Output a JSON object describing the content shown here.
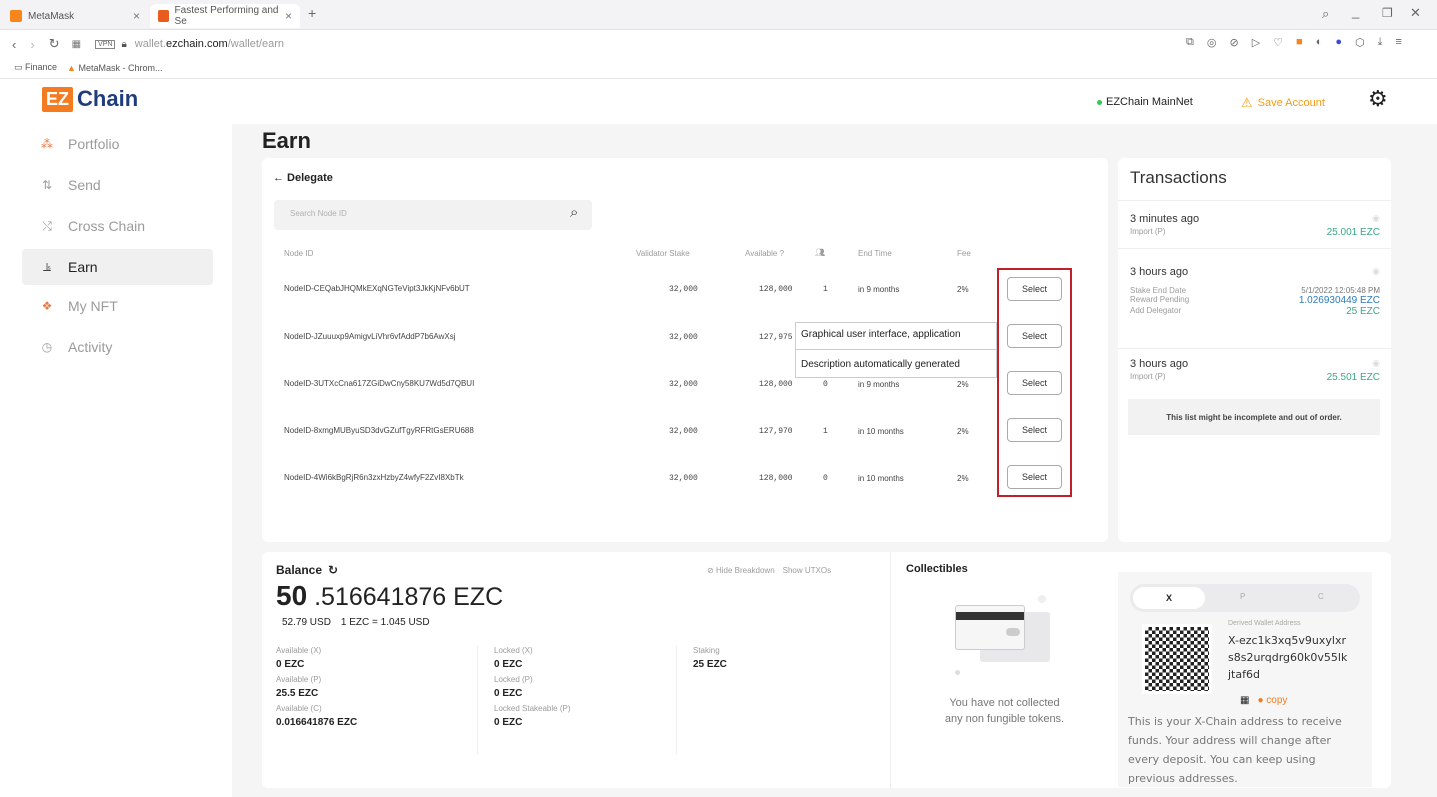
{
  "browser": {
    "tabs": [
      {
        "title": "MetaMask",
        "active": false
      },
      {
        "title": "Fastest Performing and Se",
        "active": true
      }
    ],
    "url_prefix": "wallet.",
    "url_domain": "ezchain.com",
    "url_path": "/wallet/earn",
    "bookmarks": [
      "Finance",
      "MetaMask - Chrom..."
    ]
  },
  "header": {
    "logo_badge": "EZ",
    "logo_text": "Chain",
    "network": "EZChain MainNet",
    "save_account": "Save Account",
    "network_color": "#34c759",
    "warn_color": "#f39c12"
  },
  "sidebar": {
    "items": [
      {
        "label": "Portfolio",
        "icon": "portfolio-icon"
      },
      {
        "label": "Send",
        "icon": "send-icon"
      },
      {
        "label": "Cross Chain",
        "icon": "cross-chain-icon"
      },
      {
        "label": "Earn",
        "icon": "earn-icon",
        "active": true
      },
      {
        "label": "My NFT",
        "icon": "nft-icon"
      },
      {
        "label": "Activity",
        "icon": "activity-icon"
      }
    ]
  },
  "earn": {
    "title": "Earn",
    "back_label": "← Delegate",
    "search_placeholder": "Search Node ID",
    "columns": {
      "node_id": "Node ID",
      "stake": "Validator Stake",
      "available": "Available",
      "delegators_icon": "users-icon",
      "end_time": "End Time",
      "fee": "Fee"
    },
    "rows": [
      {
        "node_id": "NodeID-CEQabJHQMkEXqNGTeVipt3JkKjNFv6bUT",
        "stake": "32,000",
        "available": "128,000",
        "delegators": "1",
        "end": "in 9 months",
        "fee": "2%",
        "select": "Select"
      },
      {
        "node_id": "NodeID-JZuuuxp9AmigvLiVhr6vfAddP7b6AwXsj",
        "stake": "32,000",
        "available": "127,975",
        "delegators": "",
        "end": "",
        "fee": "",
        "select": "Select"
      },
      {
        "node_id": "NodeID-3UTXcCna617ZGiDwCny58KU7Wd5d7QBUI",
        "stake": "32,000",
        "available": "128,000",
        "delegators": "0",
        "end": "in 9 months",
        "fee": "2%",
        "select": "Select"
      },
      {
        "node_id": "NodeID-8xmgMUByuSD3dvGZufTgyRFRtGsERU688",
        "stake": "32,000",
        "available": "127,970",
        "delegators": "1",
        "end": "in 10 months",
        "fee": "2%",
        "select": "Select"
      },
      {
        "node_id": "NodeID-4Wi6kBgRjR6n3zxHzbyZ4wfyF2ZvI8XbTk",
        "stake": "32,000",
        "available": "128,000",
        "delegators": "0",
        "end": "in 10 months",
        "fee": "2%",
        "select": "Select"
      }
    ],
    "tooltip_line1": "Graphical user interface, application",
    "tooltip_line2": "Description automatically generated",
    "highlight_color": "#c0202a"
  },
  "transactions": {
    "title": "Transactions",
    "items": [
      {
        "time": "3 minutes ago",
        "lines": [
          {
            "label": "Import (P)",
            "value": "25.001 EZC",
            "color": "#3aa981"
          }
        ]
      },
      {
        "time": "3 hours ago",
        "lines": [
          {
            "label": "Stake End Date",
            "value": "5/1/2022 12:05:48 PM",
            "color": "#777"
          },
          {
            "label": "Reward Pending",
            "value": "1.026930449 EZC",
            "color": "#2b7bb9"
          },
          {
            "label": "Add Delegator",
            "value": "25 EZC",
            "color": "#3aa981"
          }
        ]
      },
      {
        "time": "3 hours ago",
        "lines": [
          {
            "label": "Import (P)",
            "value": "25.501 EZC",
            "color": "#3aa981"
          }
        ]
      }
    ],
    "notice": "This list might be incomplete and out of order."
  },
  "balance": {
    "title": "Balance",
    "hide_breakdown": "Hide Breakdown",
    "show_utxos": "Show UTXOs",
    "amount_int": "50",
    "amount_dec": " .516641876 EZC",
    "usd": "52.79 USD",
    "rate": "1 EZC = 1.045 USD",
    "breakdown": {
      "available_x_label": "Available (X)",
      "available_x": "0 EZC",
      "available_p_label": "Available (P)",
      "available_p": "25.5 EZC",
      "available_c_label": "Available (C)",
      "available_c": "0.016641876 EZC",
      "locked_x_label": "Locked (X)",
      "locked_x": "0 EZC",
      "locked_p_label": "Locked (P)",
      "locked_p": "0 EZC",
      "locked_stakeable_label": "Locked Stakeable (P)",
      "locked_stakeable": "0 EZC",
      "staking_label": "Staking",
      "staking": "25 EZC"
    }
  },
  "collectibles": {
    "title": "Collectibles",
    "empty_line1": "You have not collected",
    "empty_line2": "any non fungible tokens."
  },
  "address": {
    "tabs": [
      "X",
      "P",
      "C"
    ],
    "derived_label": "Derived Wallet Address",
    "address_line1": "X-ezc1k3xq5v9uxylxr",
    "address_line2": "s8s2urqdrg60k0v55lk",
    "address_line3": "jtaf6d",
    "copy": "copy",
    "info": "This is your X-Chain address to receive funds. Your address will change after every deposit. You can keep using previous addresses."
  }
}
